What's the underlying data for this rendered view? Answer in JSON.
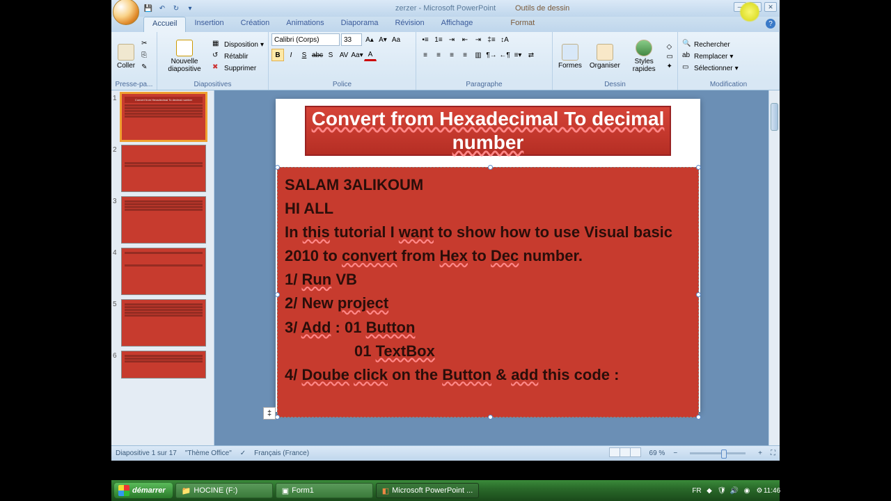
{
  "title": {
    "doc": "zerzer - Microsoft PowerPoint",
    "context_tab_group": "Outils de dessin"
  },
  "tabs": {
    "accueil": "Accueil",
    "insertion": "Insertion",
    "creation": "Création",
    "animations": "Animations",
    "diaporama": "Diaporama",
    "revision": "Révision",
    "affichage": "Affichage",
    "format": "Format"
  },
  "ribbon": {
    "presse": {
      "coller": "Coller",
      "label": "Presse-pa..."
    },
    "diapos": {
      "nouvelle": "Nouvelle diapositive",
      "disposition": "Disposition",
      "retablir": "Rétablir",
      "supprimer": "Supprimer",
      "label": "Diapositives"
    },
    "police": {
      "font": "Calibri (Corps)",
      "size": "33",
      "label": "Police"
    },
    "paragraphe": {
      "label": "Paragraphe"
    },
    "dessin": {
      "formes": "Formes",
      "organiser": "Organiser",
      "styles": "Styles rapides",
      "label": "Dessin"
    },
    "modif": {
      "rechercher": "Rechercher",
      "remplacer": "Remplacer",
      "selectionner": "Sélectionner",
      "label": "Modification"
    }
  },
  "slide": {
    "title": "Convert from Hexadecimal To decimal number",
    "line1": "SALAM 3ALIKOUM",
    "line2": "HI ALL",
    "line3a": "In ",
    "line3b": "this",
    "line3c": " tutorial I ",
    "line3d": "want",
    "line3e": " to show how to use Visual basic 2010 to ",
    "line3f": "convert",
    "line3g": " from ",
    "line3h": "Hex",
    "line3i": " to ",
    "line3j": "Dec",
    "line3k": " number.",
    "line4a": "1/ ",
    "line4b": "Run",
    "line4c": " VB",
    "line5a": "2/ New ",
    "line5b": "project",
    "line6a": "3/ ",
    "line6b": "Add",
    "line6c": " : 01 ",
    "line6d": "Button",
    "line7a": "01 ",
    "line7b": "TextBox",
    "line8a": "4/ ",
    "line8b": "Doube",
    "line8c": " ",
    "line8d": "click",
    "line8e": " on the ",
    "line8f": "Button",
    "line8g": " & ",
    "line8h": "add",
    "line8i": " this code :"
  },
  "thumbs": {
    "count": 6
  },
  "status": {
    "slide_pos": "Diapositive 1 sur 17",
    "theme": "\"Thème Office\"",
    "lang": "Français (France)",
    "zoom": "69 %"
  },
  "taskbar": {
    "start": "démarrer",
    "btn1": "HOCINE (F:)",
    "btn2": "Form1",
    "btn3": "Microsoft PowerPoint ...",
    "lang": "FR",
    "time": "11:46"
  }
}
